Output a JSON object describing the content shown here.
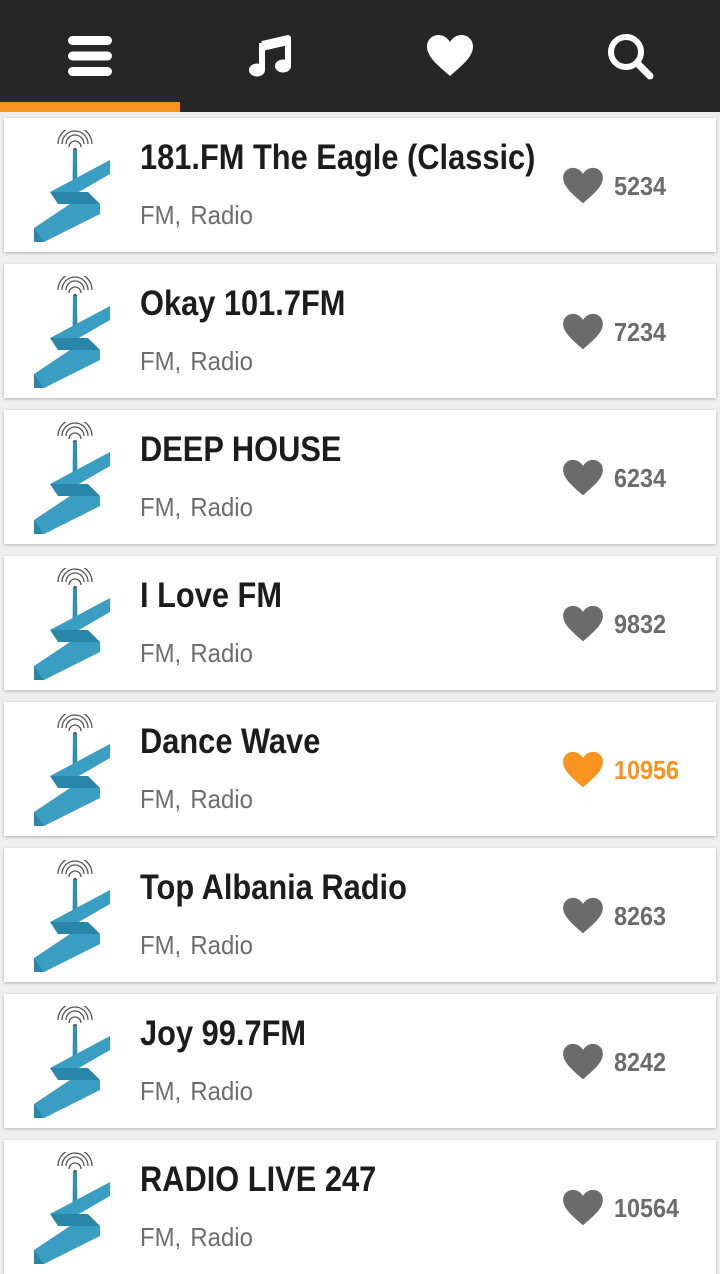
{
  "nav": {
    "tabs": [
      {
        "icon": "menu-icon",
        "active": true
      },
      {
        "icon": "music-note-icon",
        "active": false
      },
      {
        "icon": "heart-icon",
        "active": false
      },
      {
        "icon": "search-icon",
        "active": false
      }
    ],
    "accent_color": "#f7931e",
    "bar_color": "#262626"
  },
  "stations": [
    {
      "name": "181.FM The Eagle (Classic)",
      "tag1": "FM,",
      "tag2": "Radio",
      "likes": "5234",
      "liked": false
    },
    {
      "name": "Okay 101.7FM",
      "tag1": "FM,",
      "tag2": "Radio",
      "likes": "7234",
      "liked": false
    },
    {
      "name": "DEEP HOUSE",
      "tag1": "FM,",
      "tag2": "Radio",
      "likes": "6234",
      "liked": false
    },
    {
      "name": "I Love FM",
      "tag1": "FM,",
      "tag2": "Radio",
      "likes": "9832",
      "liked": false
    },
    {
      "name": "Dance Wave",
      "tag1": "FM,",
      "tag2": "Radio",
      "likes": "10956",
      "liked": true
    },
    {
      "name": "Top Albania Radio",
      "tag1": "FM,",
      "tag2": "Radio",
      "likes": "8263",
      "liked": false
    },
    {
      "name": "Joy 99.7FM",
      "tag1": "FM,",
      "tag2": "Radio",
      "likes": "8242",
      "liked": false
    },
    {
      "name": "RADIO LIVE 247",
      "tag1": "FM,",
      "tag2": "Radio",
      "likes": "10564",
      "liked": false
    }
  ],
  "colors": {
    "liked": "#f7931e",
    "unliked": "#6b6b6b",
    "logo": "#3a9ec2"
  }
}
